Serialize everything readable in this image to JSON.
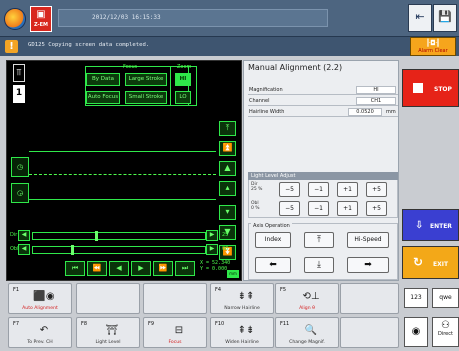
{
  "top": {
    "datetime": "2012/12/03 16:15:33",
    "zem_label": "Z-EM",
    "buttons": [
      {
        "icon": "exit-window-icon"
      },
      {
        "icon": "save-icon"
      }
    ]
  },
  "message": {
    "code_text": "GD125 Copying screen data completed."
  },
  "alarm_clear": {
    "label": "Alarm Clear"
  },
  "left": {
    "mode_number": "1",
    "focus_label": "Focus",
    "zoom_label": "Zoom",
    "focus_buttons": [
      "By Data",
      "Large Stroke",
      "Auto Focus",
      "Small Stroke"
    ],
    "zoom_buttons": [
      "HI",
      "LO"
    ],
    "light_rows": [
      {
        "label": "Dir",
        "value": "25",
        "position": 0.36
      },
      {
        "label": "Obl",
        "value": "00",
        "position": 0.22
      }
    ],
    "coords_1": "X = 52.340",
    "coords_2": "Y = 0.000",
    "unit_badge": "mm"
  },
  "info": {
    "title": "Manual Alignment (2.2)",
    "rows": [
      {
        "key": "Magnification",
        "value": "HI"
      },
      {
        "key": "Channel",
        "value": "CH1"
      },
      {
        "key": "Hairline Width",
        "value": "0.0520",
        "unit": "mm"
      }
    ],
    "light_level_adjust": {
      "title": "Light Level Adjust",
      "dir_label": "Dir",
      "dir_value": "25 %",
      "obl_label": "Obl",
      "obl_value": "0 %",
      "buttons": [
        "−5",
        "−1",
        "+1",
        "+5"
      ]
    },
    "axis_operation": {
      "title": "Axis Operation",
      "index_label": "Index",
      "speed_label": "Hi-Speed"
    }
  },
  "right": {
    "stop_label": "STOP",
    "enter_label": "ENTER",
    "exit_label": "EXIT"
  },
  "fkeys": [
    {
      "key": "F1",
      "label": "Auto Alignment",
      "red": true,
      "icon": "camera-icon"
    },
    {
      "key": "F4",
      "label": "Narrow Hairline",
      "red": false,
      "icon": "narrow-hairline-icon"
    },
    {
      "key": "F5",
      "label": "Align θ",
      "red": true,
      "icon": "theta-icon"
    },
    {
      "key": "F7",
      "label": "To Prev. CH",
      "red": false,
      "icon": "prev-channel-icon"
    },
    {
      "key": "F8",
      "label": "Light Level",
      "red": false,
      "icon": "light-icon"
    },
    {
      "key": "F9",
      "label": "Focus",
      "red": true,
      "icon": "focus-icon"
    },
    {
      "key": "F10",
      "label": "Widen Hairline",
      "red": false,
      "icon": "widen-hairline-icon"
    },
    {
      "key": "F11",
      "label": "Change Magnif.",
      "red": false,
      "icon": "magnify-icon"
    }
  ],
  "keyboard": {
    "num_label": "123",
    "qwe_label": "qwe",
    "direct_label": "Direct"
  }
}
